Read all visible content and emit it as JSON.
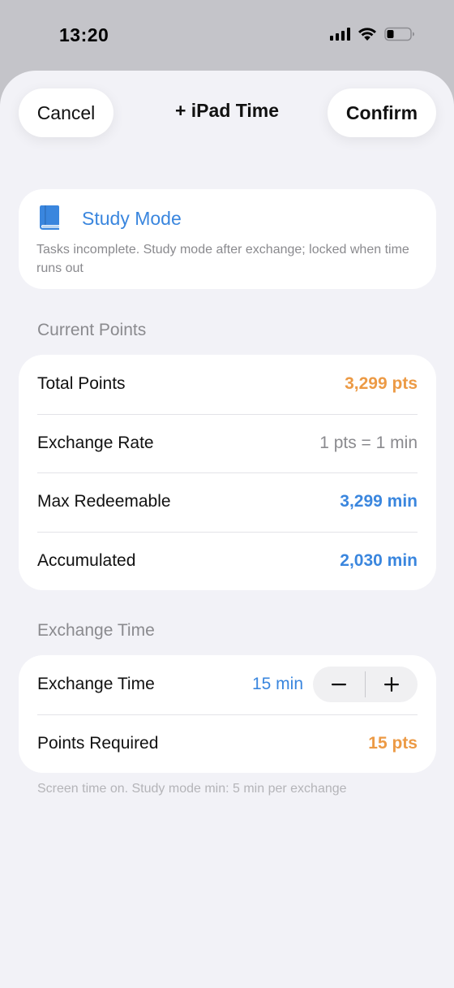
{
  "status_bar": {
    "time": "13:20",
    "icons": [
      "signal-icon",
      "wifi-icon",
      "battery-icon"
    ]
  },
  "nav": {
    "cancel_label": "Cancel",
    "title": "+ iPad Time",
    "confirm_label": "Confirm"
  },
  "mode": {
    "icon": "book-icon",
    "title": "Study Mode",
    "description": "Tasks incomplete. Study mode after exchange; locked when time runs out"
  },
  "current_points": {
    "header": "Current Points",
    "rows": [
      {
        "label": "Total Points",
        "value": "3,299 pts"
      },
      {
        "label": "Exchange Rate",
        "value": "1 pts = 1 min"
      },
      {
        "label": "Max Redeemable",
        "value": "3,299 min"
      },
      {
        "label": "Accumulated",
        "value": "2,030 min"
      }
    ]
  },
  "exchange": {
    "header": "Exchange Time",
    "time_label": "Exchange Time",
    "time_value": "15 min",
    "points_label": "Points Required",
    "points_value": "15 pts",
    "stepper_icons": [
      "minus-icon",
      "plus-icon"
    ]
  },
  "footnote": "Screen time on. Study mode min: 5 min per exchange",
  "colors": {
    "accent_blue": "#3a86de",
    "accent_orange": "#ec9a45",
    "secondary_gray": "#8a8a8e",
    "background": "#f2f2f7"
  }
}
